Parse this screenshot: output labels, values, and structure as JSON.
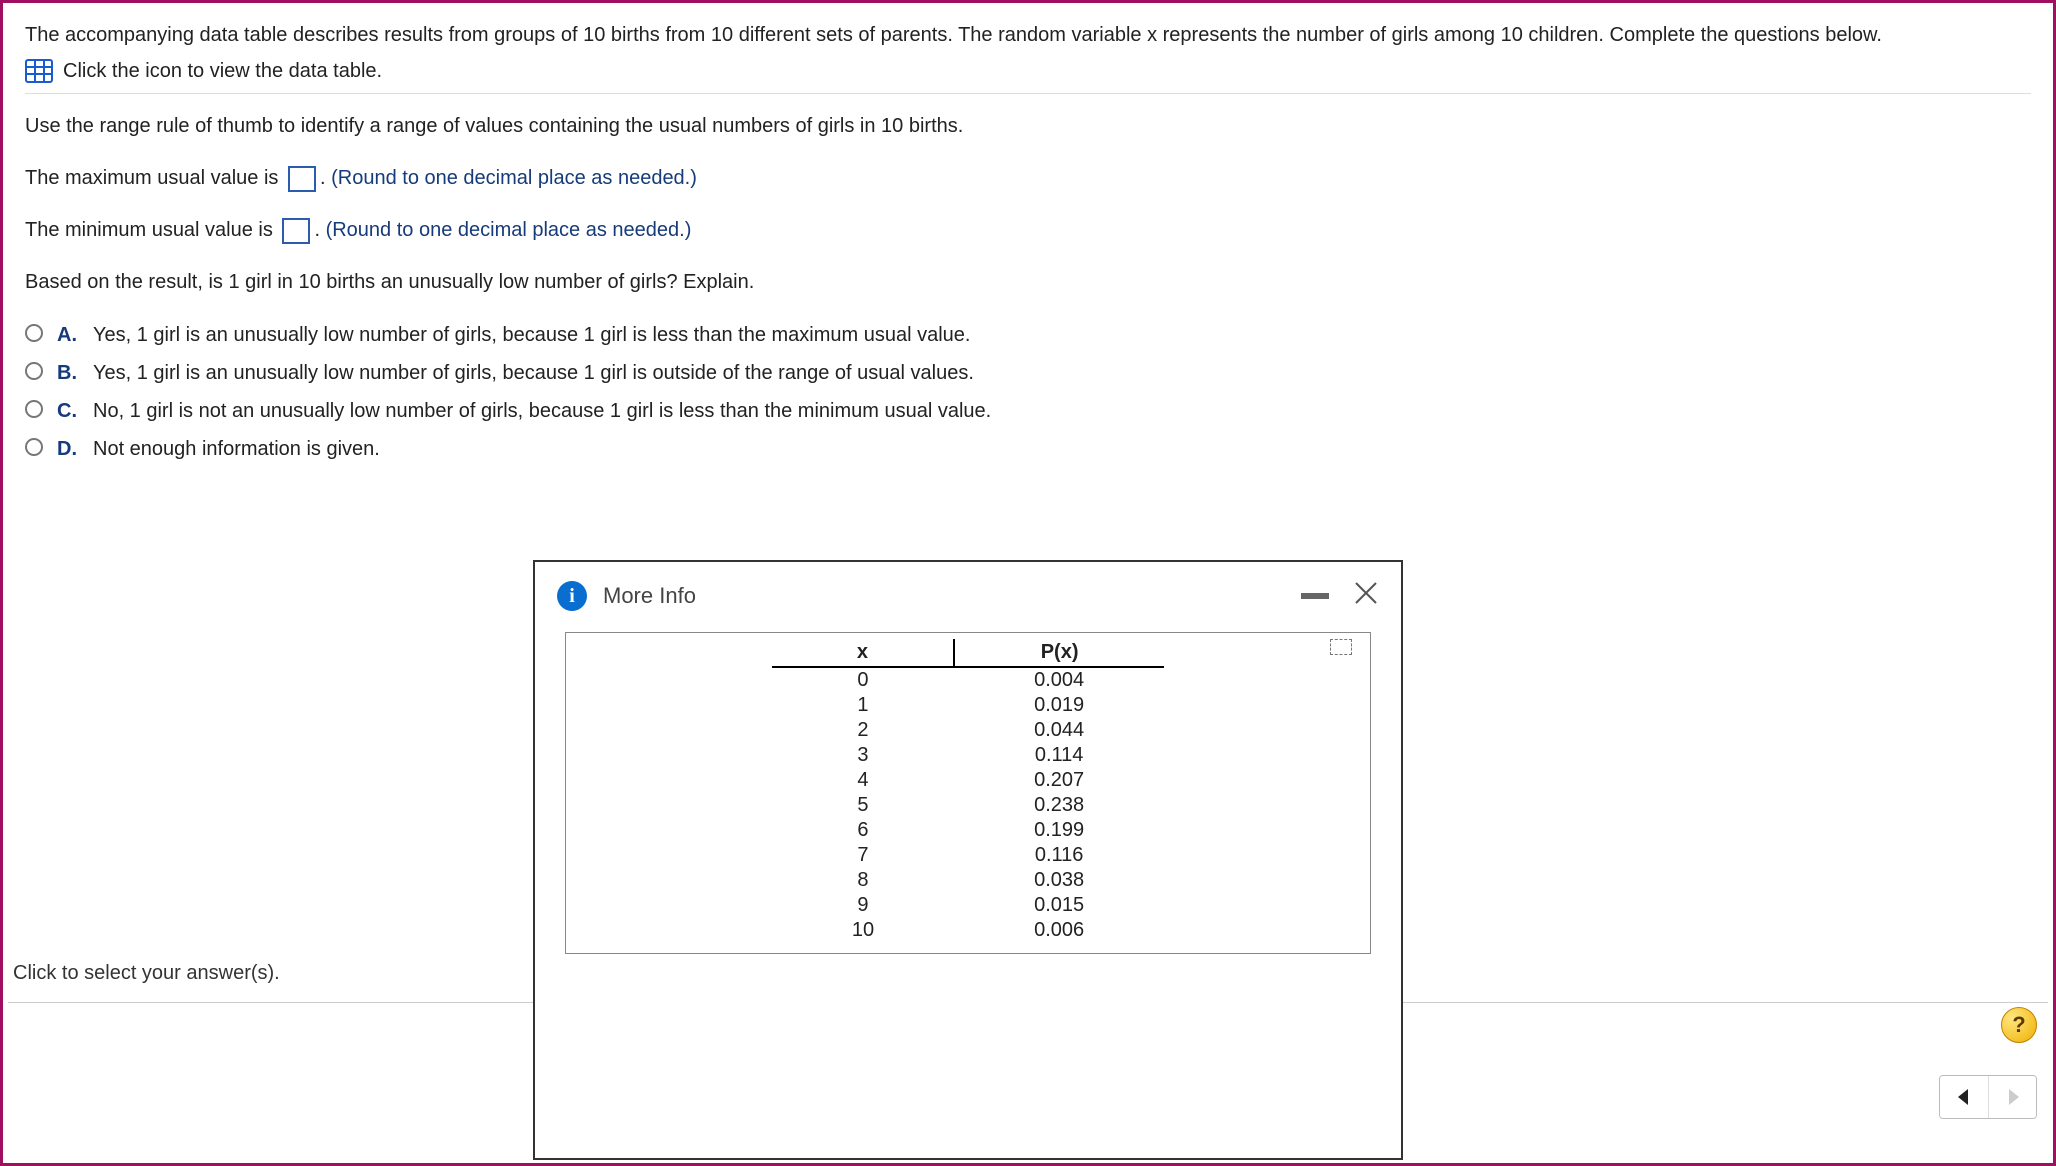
{
  "intro": {
    "text": "The accompanying data table describes results from groups of 10 births from 10 different sets of parents. The random variable x represents the number of girls among 10 children. Complete the questions below.",
    "icon_hint": "Click the icon to view the data table."
  },
  "question": {
    "range_prompt": "Use the range rule of thumb to identify a range of values containing the usual numbers of girls in 10 births.",
    "max_prefix": "The maximum usual value is ",
    "min_prefix": "The minimum usual value is ",
    "round_hint": "(Round to one decimal place as needed.)",
    "followup": "Based on the result, is 1 girl in 10 births an unusually low number of girls? Explain."
  },
  "choices": [
    {
      "label": "A.",
      "text": "Yes, 1 girl is an unusually low number of girls, because 1 girl is less than the maximum usual value."
    },
    {
      "label": "B.",
      "text": "Yes, 1 girl is an unusually low number of girls, because 1 girl is outside of the range of usual values."
    },
    {
      "label": "C.",
      "text": "No, 1 girl is not an unusually low number of girls, because 1 girl is less than the minimum usual value."
    },
    {
      "label": "D.",
      "text": "Not enough information is given."
    }
  ],
  "footer_hint": "Click to select your answer(s).",
  "modal": {
    "title": "More Info",
    "headers": {
      "x": "x",
      "px": "P(x)"
    },
    "rows": [
      {
        "x": "0",
        "px": "0.004"
      },
      {
        "x": "1",
        "px": "0.019"
      },
      {
        "x": "2",
        "px": "0.044"
      },
      {
        "x": "3",
        "px": "0.114"
      },
      {
        "x": "4",
        "px": "0.207"
      },
      {
        "x": "5",
        "px": "0.238"
      },
      {
        "x": "6",
        "px": "0.199"
      },
      {
        "x": "7",
        "px": "0.116"
      },
      {
        "x": "8",
        "px": "0.038"
      },
      {
        "x": "9",
        "px": "0.015"
      },
      {
        "x": "10",
        "px": "0.006"
      }
    ]
  },
  "help_label": "?",
  "chart_data": {
    "type": "table",
    "title": "Probability distribution of number of girls in 10 births",
    "columns": [
      "x",
      "P(x)"
    ],
    "rows": [
      [
        0,
        0.004
      ],
      [
        1,
        0.019
      ],
      [
        2,
        0.044
      ],
      [
        3,
        0.114
      ],
      [
        4,
        0.207
      ],
      [
        5,
        0.238
      ],
      [
        6,
        0.199
      ],
      [
        7,
        0.116
      ],
      [
        8,
        0.038
      ],
      [
        9,
        0.015
      ],
      [
        10,
        0.006
      ]
    ]
  }
}
